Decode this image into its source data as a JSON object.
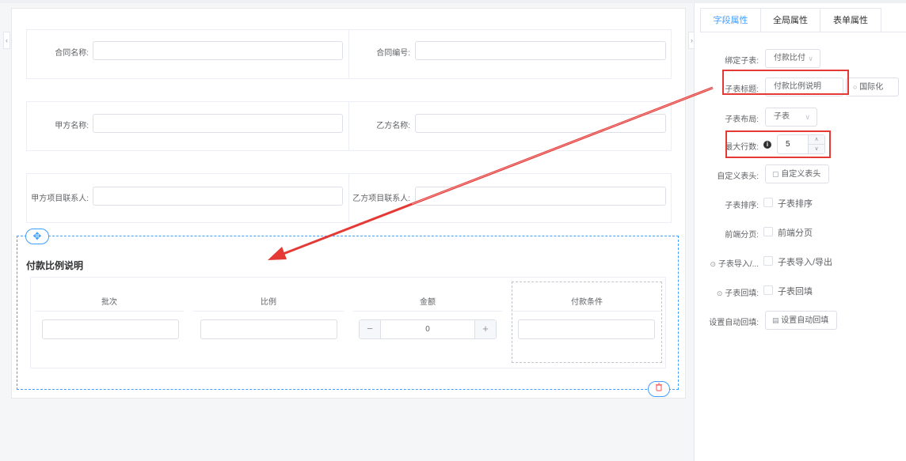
{
  "form": {
    "contract_name_label": "合同名称:",
    "contract_no_label": "合同编号:",
    "party_a_name_label": "甲方名称:",
    "party_b_name_label": "乙方名称:",
    "party_a_contact_label": "甲方项目联系人:",
    "party_b_contact_label": "乙方项目联系人:"
  },
  "subtable": {
    "title": "付款比例说明",
    "columns": [
      "批次",
      "比例",
      "金额",
      "付款条件"
    ],
    "amount_value": "0",
    "minus": "−",
    "plus": "+"
  },
  "panel": {
    "tabs": [
      "字段属性",
      "全局属性",
      "表单属性"
    ],
    "bind_label": "绑定子表:",
    "bind_value": "付款比付",
    "title_label": "子表标题:",
    "title_value": "付款比例说明",
    "i18n_button": "国际化",
    "layout_label": "子表布局:",
    "layout_value": "子表",
    "max_rows_label": "最大行数:",
    "max_rows_value": "5",
    "custom_header_label": "自定义表头:",
    "custom_header_button": "自定义表头",
    "sort_label": "子表排序:",
    "sort_check": "子表排序",
    "paging_label": "前端分页:",
    "paging_check": "前端分页",
    "import_label": "子表导入/...",
    "import_check": "子表导入/导出",
    "backfill_label": "子表回填:",
    "backfill_check": "子表回填",
    "autofill_label": "设置自动回填:",
    "autofill_button": "设置自动回填"
  },
  "colors": {
    "accent": "#409eff",
    "highlight": "#e53935",
    "danger": "#f56c6c"
  }
}
